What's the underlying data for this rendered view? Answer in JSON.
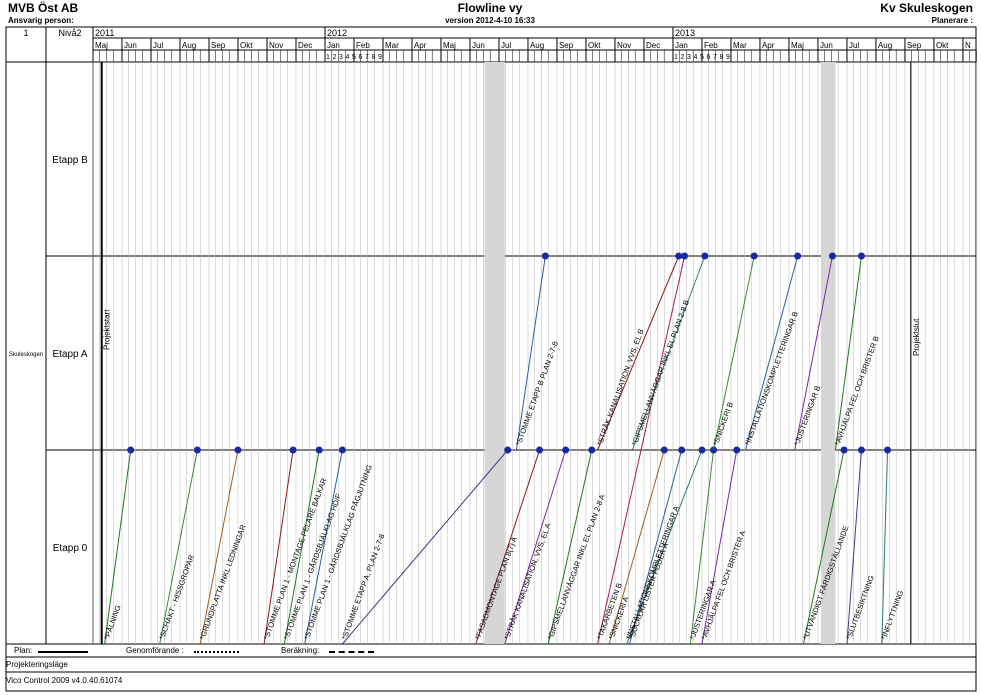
{
  "header": {
    "company": "MVB Öst AB",
    "responsible_label": "Ansvarig person:",
    "title": "Flowline vy",
    "version": "version 2012-4-10 16:33",
    "project": "Kv Skuleskogen",
    "planner_label": "Planerare :"
  },
  "left_header": {
    "index": "1",
    "level": "Nivå2"
  },
  "chart_data": {
    "type": "flowline",
    "years": [
      "2011",
      "2012",
      "2013"
    ],
    "months": [
      "Maj",
      "Jun",
      "Jul",
      "Aug",
      "Sep",
      "Okt",
      "Nov",
      "Dec",
      "Jan",
      "Feb",
      "Mar",
      "Apr",
      "Maj",
      "Jun",
      "Jul",
      "Aug",
      "Sep",
      "Okt",
      "Nov",
      "Dec",
      "Jan",
      "Feb",
      "Mar",
      "Apr",
      "Maj",
      "Jun",
      "Jul",
      "Aug",
      "Sep",
      "Okt",
      "N"
    ],
    "week_ticks_2012_jan": [
      "1",
      "2",
      "3",
      "4",
      "5",
      "6",
      "7",
      "8",
      "9"
    ],
    "week_ticks_2013_jan": [
      "1",
      "2",
      "3",
      "4",
      "5",
      "6",
      "7",
      "8",
      "9"
    ],
    "location_group": "Skuleskogen",
    "locations": [
      "Etapp B",
      "Etapp A",
      "Etapp 0"
    ],
    "milestones": [
      "Projektstart",
      "Projektslut"
    ],
    "tasks": [
      {
        "name": "*STOMME ETAPP B PLAN 2-7-8",
        "start": 14.6,
        "end": 15.6,
        "from": 1,
        "to": 2,
        "color": "#2a5fa8"
      },
      {
        "name": "*STOMME ETAPP A, PLAN 2-7-8",
        "start": 8.6,
        "end": 14.3,
        "from": 0,
        "to": 1,
        "color": "#3b3b8f"
      },
      {
        "name": "*FASADMONTAGE PLAN 8(7) A",
        "start": 13.2,
        "end": 15.4,
        "from": 0,
        "to": 1,
        "color": "#8b1a1a"
      },
      {
        "name": "*GIPSMELLANVÄGGAR INKL EL PLAN 2-8 A",
        "start": 15.7,
        "end": 17.2,
        "from": 0,
        "to": 1,
        "color": "#1f7a1f"
      },
      {
        "name": "*STRÅK KANALISATION, VVS, EL A",
        "start": 14.2,
        "end": 16.3,
        "from": 0,
        "to": 1,
        "color": "#7a2aa8"
      },
      {
        "name": "*INSTALLATIONSKOMPLETTERINGAR A",
        "start": 18.4,
        "end": 21.0,
        "from": 0,
        "to": 1,
        "color": "#2a7a7a"
      },
      {
        "name": "*SNICKERI A",
        "start": 17.8,
        "end": 19.7,
        "from": 0,
        "to": 1,
        "color": "#a85a1a"
      },
      {
        "name": "*SOCKLAR LISTER FODER A",
        "start": 18.5,
        "end": 20.3,
        "from": 0,
        "to": 1,
        "color": "#2a5fa8"
      },
      {
        "name": "*JUSTERINGAR A",
        "start": 20.6,
        "end": 21.4,
        "from": 0,
        "to": 1,
        "color": "#3a8a3a"
      },
      {
        "name": "*AVHJÄLPA FEL OCH BRISTER A",
        "start": 21.0,
        "end": 22.2,
        "from": 0,
        "to": 1,
        "color": "#7a2aa8"
      },
      {
        "name": "*UTVÄNDIGT FÄRDIGSTÄLLANDE",
        "start": 24.5,
        "end": 25.9,
        "from": 0,
        "to": 1,
        "color": "#1f7a1f"
      },
      {
        "name": "*TAKARBETEN B",
        "start": 17.4,
        "end": 20.4,
        "from": 0,
        "to": 2,
        "color": "#a81a5a"
      },
      {
        "name": "*STRÅK KANALISATION, VVS, EL B",
        "start": 17.4,
        "end": 20.2,
        "from": 1,
        "to": 2,
        "color": "#8b1a1a"
      },
      {
        "name": "*GIPSMELLANVÄGGAR INKL EL PLAN 2-8 B",
        "start": 18.6,
        "end": 21.1,
        "from": 1,
        "to": 2,
        "color": "#2a7a7a"
      },
      {
        "name": "*SNICKERI B",
        "start": 21.4,
        "end": 22.8,
        "from": 1,
        "to": 2,
        "color": "#3a8a3a"
      },
      {
        "name": "*INSTALLATIONSKOMPLETTERINGAR B",
        "start": 22.5,
        "end": 24.3,
        "from": 1,
        "to": 2,
        "color": "#2a5fa8"
      },
      {
        "name": "*JUSTERINGAR B",
        "start": 24.2,
        "end": 25.5,
        "from": 1,
        "to": 2,
        "color": "#7a2aa8"
      },
      {
        "name": "*AVHJÄLPA FEL OCH BRISTER B",
        "start": 25.6,
        "end": 26.5,
        "from": 1,
        "to": 2,
        "color": "#1f7a1f"
      },
      {
        "name": "*SCHAKT - HISSGROPAR",
        "start": 2.3,
        "end": 3.6,
        "from": 0,
        "to": 1,
        "color": "#3a8a3a"
      },
      {
        "name": "*GRUNDPLATTA INKL LEDNINGAR",
        "start": 3.7,
        "end": 5.0,
        "from": 0,
        "to": 1,
        "color": "#a85a1a"
      },
      {
        "name": "*STOMME PLAN 1 - MONTAGE PELARE BALKAR",
        "start": 5.9,
        "end": 6.9,
        "from": 0,
        "to": 1,
        "color": "#8b1a1a"
      },
      {
        "name": "*STOMME PLAN 1 - GÅRDSBJÄLKLAG HD/F",
        "start": 6.6,
        "end": 7.8,
        "from": 0,
        "to": 1,
        "color": "#1f7a1f"
      },
      {
        "name": "*STOMME PLAN 1 - GÅRDSBJÄLKLAG PÅGJUTNING",
        "start": 7.3,
        "end": 8.6,
        "from": 0,
        "to": 1,
        "color": "#2a5fa8"
      },
      {
        "name": "*PÅLNING",
        "start": 0.4,
        "end": 1.3,
        "from": 0,
        "to": 1,
        "color": "#1f7a1f"
      },
      {
        "name": "*INFLYTTNING",
        "start": 27.2,
        "end": 27.4,
        "from": 0,
        "to": 1,
        "color": "#2a7a7a"
      },
      {
        "name": "*SLUTBESIKTNING",
        "start": 26.0,
        "end": 26.5,
        "from": 0,
        "to": 1,
        "color": "#3b3b8f"
      }
    ],
    "shaded_weeks": [
      {
        "start": 13.5,
        "end": 14.2
      },
      {
        "start": 25.1,
        "end": 25.6
      }
    ]
  },
  "legend": {
    "plan_label": "Plan:",
    "execution_label": "Genomförande :",
    "calc_label": "Beräkning:"
  },
  "footer": {
    "mode": "Projekteringsläge",
    "software": "Vico Control 2009 v4.0.40.61074"
  }
}
